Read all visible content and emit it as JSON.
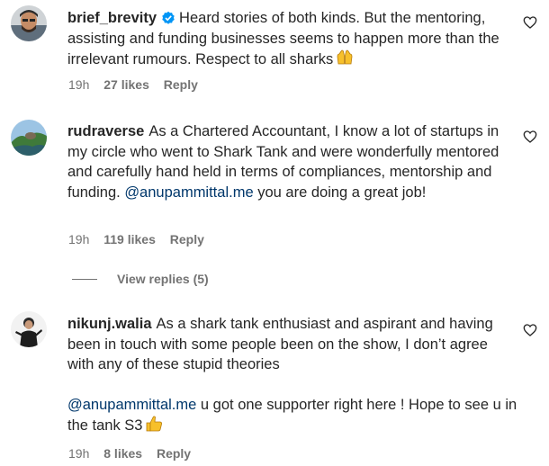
{
  "comments": [
    {
      "username": "brief_brevity",
      "verified": true,
      "text": "Heard stories of both kinds. But the mentoring, assisting and funding businesses seems to happen more than the irrelevant rumours. Respect to all sharks",
      "emoji_icon": "raising-hands-emoji",
      "time": "19h",
      "likes": "27 likes",
      "reply": "Reply"
    },
    {
      "username": "rudraverse",
      "verified": false,
      "text_before": "As a Chartered Accountant, I know a lot of startups in my circle who went to Shark Tank and were wonderfully mentored and carefully hand held in terms of compliances, mentorship and funding.",
      "mention": "@anupammittal.me",
      "text_after": "you are doing a great job!",
      "time": "19h",
      "likes": "119 likes",
      "reply": "Reply",
      "view_replies": "View replies (5)"
    },
    {
      "username": "nikunj.walia",
      "verified": false,
      "text": "As a shark tank enthusiast and aspirant and having been in touch with some people been on the show, I don’t agree with any of these stupid theories",
      "mention": "@anupammittal.me",
      "text_after": "u got one supporter right here ! Hope to see u in the tank S3",
      "emoji_icon": "thumbs-up-emoji",
      "time": "19h",
      "likes": "8 likes",
      "reply": "Reply"
    }
  ],
  "colors": {
    "text": "#262626",
    "secondary": "#737373",
    "mention": "#00376b",
    "verified": "#0095f6"
  }
}
